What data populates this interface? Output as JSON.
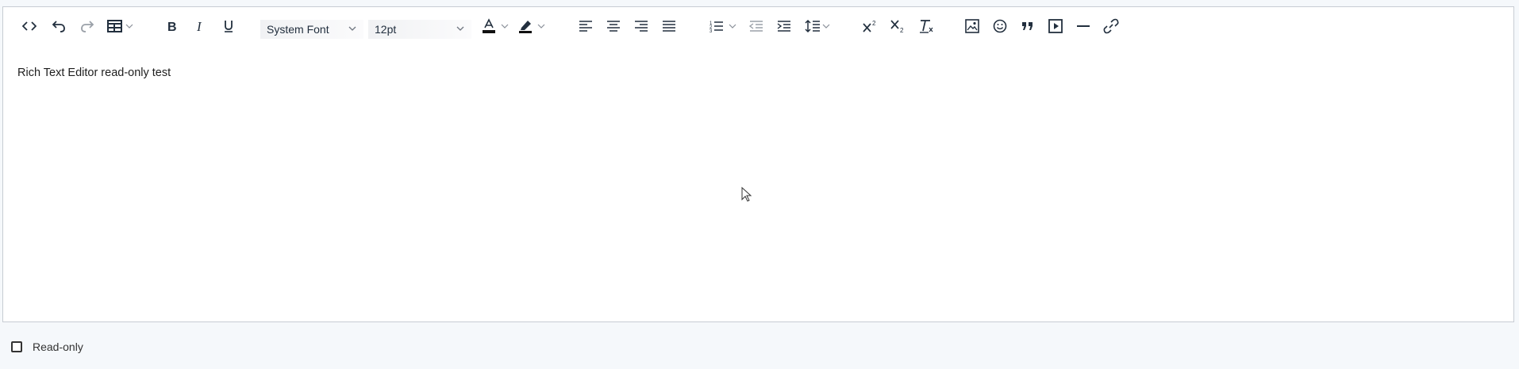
{
  "toolbar": {
    "font_family": {
      "value": "System Font"
    },
    "font_size": {
      "value": "12pt"
    },
    "buttons": [
      "source-code",
      "undo",
      "redo",
      "table",
      "bold",
      "italic",
      "underline",
      "text-color",
      "highlight-color",
      "align-left",
      "align-center",
      "align-right",
      "justify",
      "numbered-list",
      "outdent",
      "indent",
      "line-height",
      "superscript",
      "subscript",
      "clear-formatting",
      "image",
      "emoticons",
      "blockquote",
      "media",
      "horizontal-line",
      "link"
    ]
  },
  "content": {
    "text": "Rich Text Editor read-only test"
  },
  "footer": {
    "readonly_label": "Read-only",
    "readonly_checked": false
  },
  "colors": {
    "border": "#c7ccd3",
    "icon": "#222f3e",
    "disabled_icon": "#9aa0a8",
    "page_bg": "#f5f8fb"
  }
}
